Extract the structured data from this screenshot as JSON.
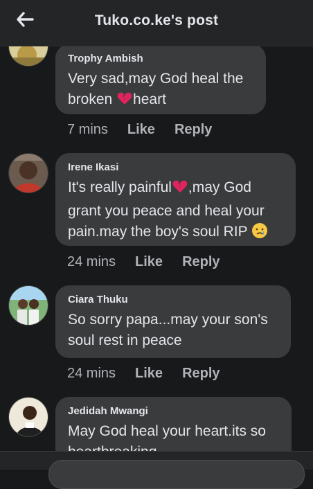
{
  "header": {
    "title": "Tuko.co.ke's post",
    "back_icon": "arrow-left-icon"
  },
  "comments": [
    {
      "author": "Trophy Ambish",
      "text_a": "Very sad,may God heal the",
      "text_b": "broken ",
      "emoji_b": "broken-heart-emoji",
      "text_c": "heart",
      "time": "7 mins",
      "like": "Like",
      "reply": "Reply"
    },
    {
      "author": "Irene Ikasi",
      "text_a": "It's really painful",
      "emoji_a": "broken-heart-emoji",
      "text_b": ",may God",
      "text_c": "grant you peace and heal your",
      "text_d": "pain.may the boy's soul RIP ",
      "emoji_d": "crying-face-emoji",
      "time": "24 mins",
      "like": "Like",
      "reply": "Reply"
    },
    {
      "author": "Ciara Thuku",
      "text_a": "So sorry papa...may your son's",
      "text_b": "soul rest in peace",
      "time": "24 mins",
      "like": "Like",
      "reply": "Reply"
    },
    {
      "author": "Jedidah Mwangi",
      "text_a": "May God heal your heart.its so",
      "text_b": "heartbreaking"
    }
  ],
  "colors": {
    "background": "#18191a",
    "bubble": "#3a3b3c",
    "text": "#e4e6eb",
    "secondary_text": "#b0b3b8",
    "broken_heart": "#e0245e"
  }
}
